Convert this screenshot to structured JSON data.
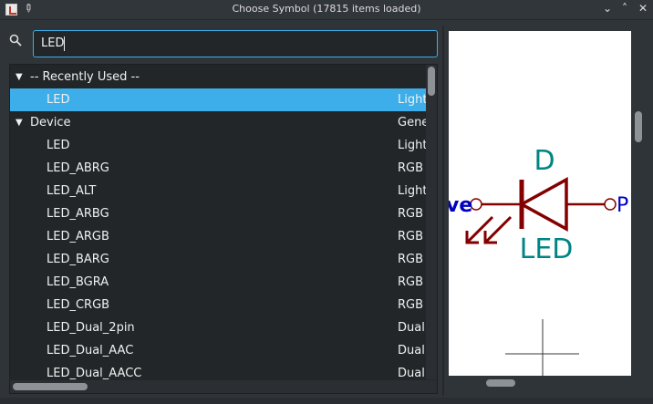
{
  "window": {
    "title": "Choose Symbol (17815 items loaded)",
    "minimize_glyph": "⌄",
    "maximize_glyph": "˄",
    "close_glyph": "✕"
  },
  "search": {
    "value": "LED",
    "icon": "search-icon"
  },
  "tree": {
    "rows": [
      {
        "type": "group",
        "arrow": "▼",
        "name": "-- Recently Used --",
        "desc": "",
        "selected": false
      },
      {
        "type": "item",
        "name": "LED",
        "desc": "Light",
        "selected": true
      },
      {
        "type": "group",
        "arrow": "▼",
        "name": "Device",
        "desc": "Gene",
        "selected": false
      },
      {
        "type": "item",
        "name": "LED",
        "desc": "Light",
        "selected": false
      },
      {
        "type": "item",
        "name": "LED_ABRG",
        "desc": "RGB",
        "selected": false
      },
      {
        "type": "item",
        "name": "LED_ALT",
        "desc": "Light",
        "selected": false
      },
      {
        "type": "item",
        "name": "LED_ARBG",
        "desc": "RGB",
        "selected": false
      },
      {
        "type": "item",
        "name": "LED_ARGB",
        "desc": "RGB",
        "selected": false
      },
      {
        "type": "item",
        "name": "LED_BARG",
        "desc": "RGB",
        "selected": false
      },
      {
        "type": "item",
        "name": "LED_BGRA",
        "desc": "RGB",
        "selected": false
      },
      {
        "type": "item",
        "name": "LED_CRGB",
        "desc": "RGB",
        "selected": false
      },
      {
        "type": "item",
        "name": "LED_Dual_2pin",
        "desc": "Dual",
        "selected": false
      },
      {
        "type": "item",
        "name": "LED_Dual_AAC",
        "desc": "Dual",
        "selected": false
      },
      {
        "type": "item",
        "name": "LED_Dual_AACC",
        "desc": "Dual",
        "selected": false
      }
    ]
  },
  "preview": {
    "reference": "D",
    "value": "LED",
    "pin_left_label": "ve",
    "pin_right_label": "P",
    "colors": {
      "body": "#840000",
      "field": "#008484",
      "pin_name": "#0000c2"
    }
  },
  "colors": {
    "selection": "#3daee9",
    "background": "#2f3438",
    "list_background": "#232629"
  }
}
